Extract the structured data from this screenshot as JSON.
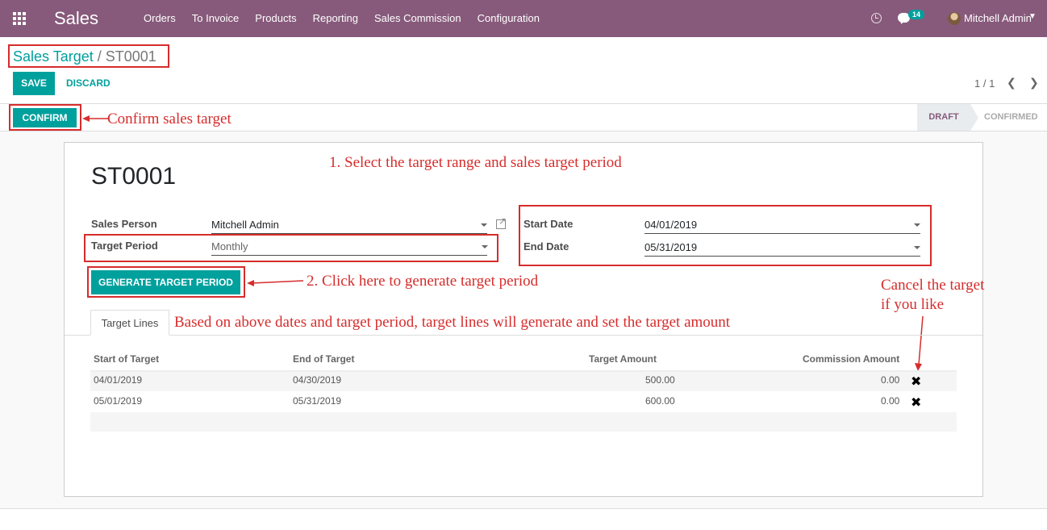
{
  "navbar": {
    "app_name": "Sales",
    "menu": [
      "Orders",
      "To Invoice",
      "Products",
      "Reporting",
      "Sales Commission",
      "Configuration"
    ],
    "chat_badge": "14",
    "user_name": "Mitchell Admin"
  },
  "breadcrumb": {
    "parent": "Sales Target",
    "separator": "/",
    "current": "ST0001"
  },
  "actions": {
    "save_label": "SAVE",
    "discard_label": "DISCARD",
    "confirm_label": "CONFIRM"
  },
  "pager": {
    "value": "1 / 1"
  },
  "status": {
    "stages": [
      "DRAFT",
      "CONFIRMED"
    ],
    "active": "DRAFT"
  },
  "form": {
    "name": "ST0001",
    "sales_person_label": "Sales Person",
    "sales_person": "Mitchell Admin",
    "target_period_label": "Target Period",
    "target_period": "Monthly",
    "start_date_label": "Start Date",
    "start_date": "04/01/2019",
    "end_date_label": "End Date",
    "end_date": "05/31/2019",
    "generate_label": "GENERATE TARGET PERIOD"
  },
  "tabs": [
    "Target Lines"
  ],
  "table": {
    "headers": [
      "Start of Target",
      "End of Target",
      "Target Amount",
      "Commission Amount"
    ],
    "rows": [
      {
        "start": "04/01/2019",
        "end": "04/30/2019",
        "target": "500.00",
        "commission": "0.00"
      },
      {
        "start": "05/01/2019",
        "end": "05/31/2019",
        "target": "600.00",
        "commission": "0.00"
      }
    ]
  },
  "annotations": {
    "confirm_note": "Confirm sales target",
    "step1_note": "1. Select the target range and sales target period",
    "step2_note": "2. Click here to generate target period",
    "lines_note": "Based on above dates and target period, target lines will generate and set the target amount",
    "cancel_note_line1": "Cancel the target",
    "cancel_note_line2": "if you like"
  },
  "colors": {
    "navbar": "#875a7b",
    "primary": "#00a09d",
    "annotation": "#d62c2c"
  },
  "icons": [
    "apps-icon",
    "clock-icon",
    "chat-icon",
    "external-link-icon",
    "delete-icon",
    "chevron-left-icon",
    "chevron-right-icon"
  ]
}
